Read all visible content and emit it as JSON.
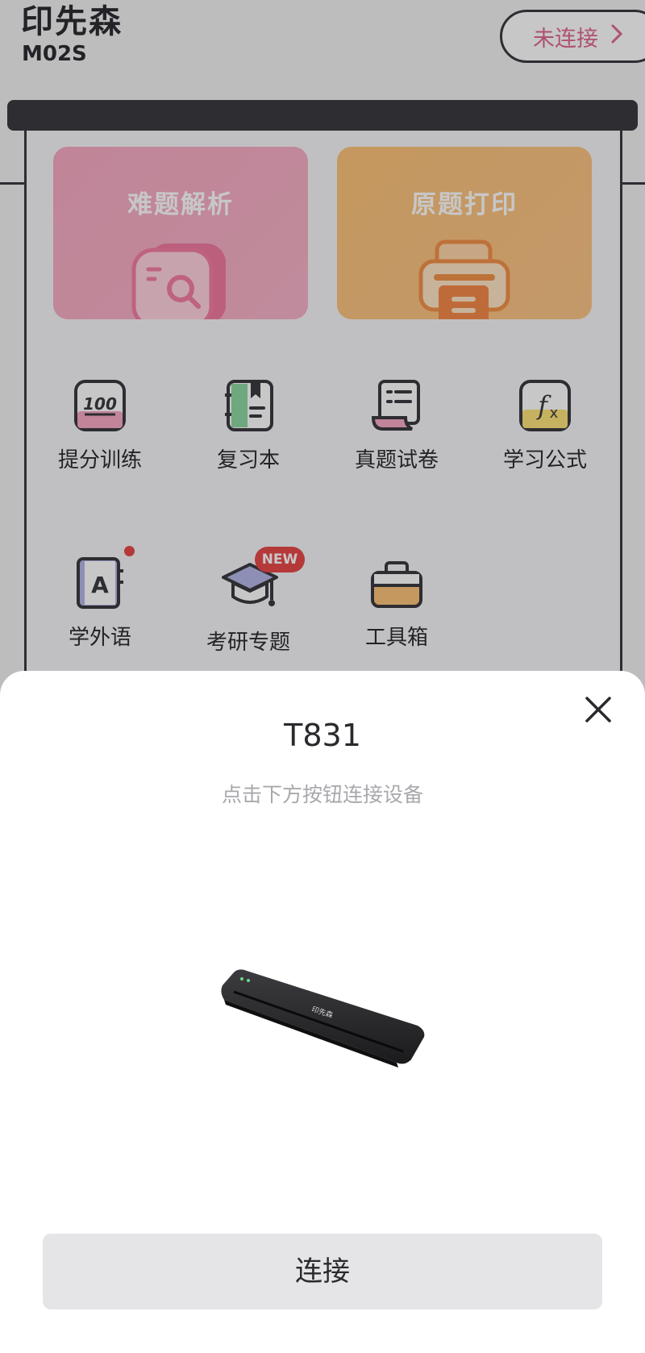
{
  "header": {
    "brand": "印先森",
    "model": "M02S",
    "connection_label": "未连接"
  },
  "cards": [
    {
      "title": "难题解析",
      "icon": "camera-search-icon"
    },
    {
      "title": "原题打印",
      "icon": "printer-icon"
    }
  ],
  "grid": [
    {
      "label": "提分训练",
      "icon": "score-100-icon"
    },
    {
      "label": "复习本",
      "icon": "bookmark-notebook-icon"
    },
    {
      "label": "真题试卷",
      "icon": "scroll-paper-icon"
    },
    {
      "label": "学习公式",
      "icon": "fx-formula-icon"
    },
    {
      "label": "学外语",
      "icon": "language-book-icon"
    },
    {
      "label": "考研专题",
      "icon": "graduation-cap-icon",
      "badge": "NEW"
    },
    {
      "label": "工具箱",
      "icon": "toolbox-icon"
    }
  ],
  "sheet": {
    "title": "T831",
    "subtitle": "点击下方按钮连接设备",
    "device_logo_text": "印先森",
    "connect_label": "连接"
  },
  "colors": {
    "accent_pink": "#e0698f",
    "badge_red": "#ea4a4a",
    "card_pink": "#f8aac3",
    "card_orange": "#fdc37a"
  }
}
